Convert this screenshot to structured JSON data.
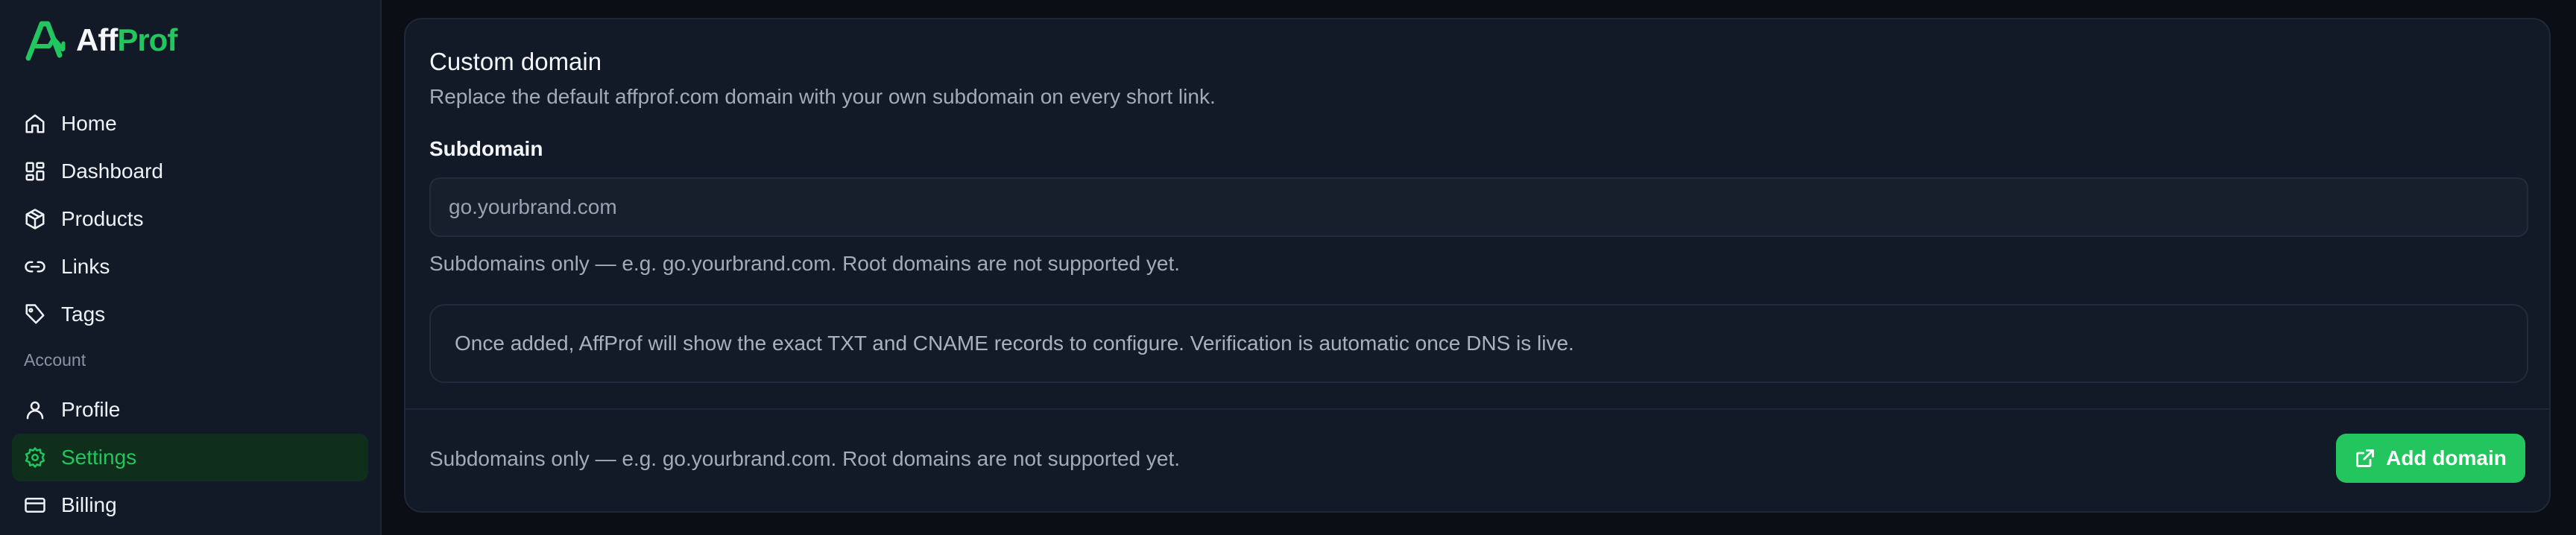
{
  "brand": {
    "name_part1": "Aff",
    "name_part2": "Prof",
    "accent": "#22c55e"
  },
  "sidebar": {
    "items": [
      {
        "label": "Home",
        "icon": "home-icon"
      },
      {
        "label": "Dashboard",
        "icon": "dashboard-icon"
      },
      {
        "label": "Products",
        "icon": "box-icon"
      },
      {
        "label": "Links",
        "icon": "link-icon"
      },
      {
        "label": "Tags",
        "icon": "tag-icon"
      }
    ],
    "section_label": "Account",
    "account_items": [
      {
        "label": "Profile",
        "icon": "user-icon"
      },
      {
        "label": "Settings",
        "icon": "gear-icon",
        "active": true
      },
      {
        "label": "Billing",
        "icon": "credit-card-icon"
      }
    ]
  },
  "custom_domain": {
    "title": "Custom domain",
    "description": "Replace the default affprof.com domain with your own subdomain on every short link.",
    "field_label": "Subdomain",
    "input_value": "",
    "input_placeholder": "go.yourbrand.com",
    "hint": "Subdomains only — e.g. go.yourbrand.com. Root domains are not supported yet.",
    "info": "Once added, AffProf will show the exact TXT and CNAME records to configure. Verification is automatic once DNS is live.",
    "footer_hint": "Subdomains only — e.g. go.yourbrand.com. Root domains are not supported yet.",
    "add_button_label": "Add domain",
    "add_button_icon": "external-link-icon"
  }
}
